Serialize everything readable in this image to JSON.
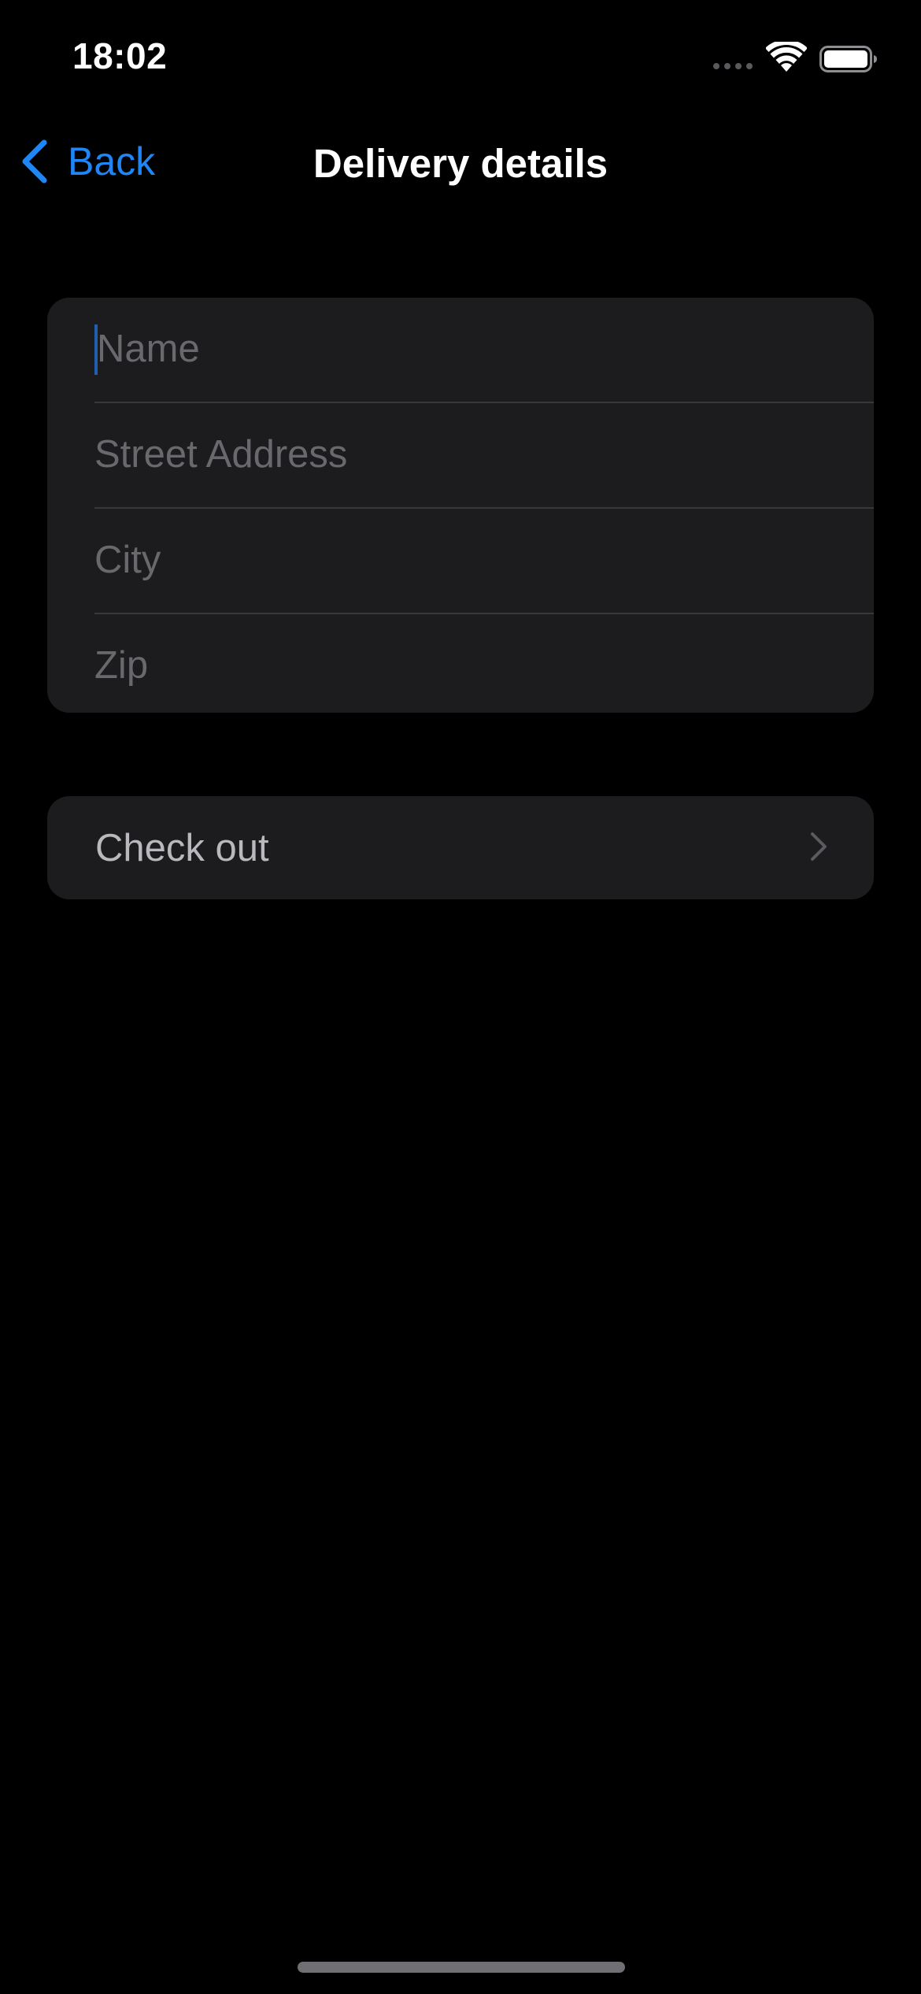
{
  "status_bar": {
    "time": "18:02"
  },
  "nav": {
    "back_label": "Back",
    "title": "Delivery details"
  },
  "form": {
    "fields": [
      {
        "placeholder": "Name",
        "value": ""
      },
      {
        "placeholder": "Street Address",
        "value": ""
      },
      {
        "placeholder": "City",
        "value": ""
      },
      {
        "placeholder": "Zip",
        "value": ""
      }
    ]
  },
  "checkout": {
    "label": "Check out"
  },
  "colors": {
    "background": "#000000",
    "group_background": "#1c1c1e",
    "accent": "#1e86f5",
    "placeholder": "#68686d",
    "separator": "#38383a"
  },
  "icons": {
    "back": "chevron-left-icon",
    "checkout": "chevron-right-icon",
    "wifi": "wifi-icon",
    "battery": "battery-icon",
    "signal": "cellular-signal-icon"
  }
}
